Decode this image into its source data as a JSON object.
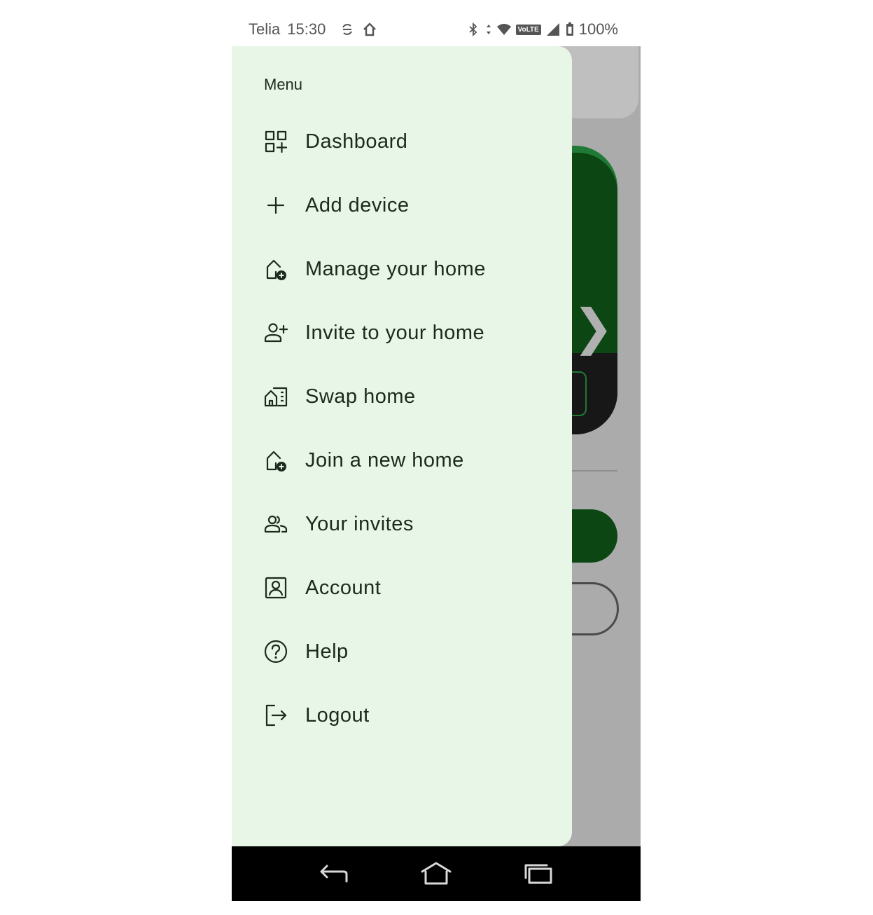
{
  "status_bar": {
    "carrier": "Telia",
    "time": "15:30",
    "network_badge": "VoLTE",
    "battery": "100%",
    "icons": [
      "sync-icon",
      "home-icon",
      "bluetooth-icon",
      "data-arrows-icon",
      "wifi-icon",
      "signal-icon",
      "battery-icon"
    ]
  },
  "drawer": {
    "title": "Menu",
    "items": [
      {
        "label": "Dashboard",
        "icon": "dashboard-icon"
      },
      {
        "label": "Add device",
        "icon": "plus-icon"
      },
      {
        "label": "Manage your home",
        "icon": "home-add-icon"
      },
      {
        "label": "Invite to your home",
        "icon": "person-add-icon"
      },
      {
        "label": "Swap home",
        "icon": "home-swap-icon"
      },
      {
        "label": "Join a new home",
        "icon": "home-add-icon"
      },
      {
        "label": "Your invites",
        "icon": "people-icon"
      },
      {
        "label": "Account",
        "icon": "account-box-icon"
      },
      {
        "label": "Help",
        "icon": "help-icon"
      },
      {
        "label": "Logout",
        "icon": "logout-icon"
      }
    ]
  },
  "nav_bar": {
    "buttons": [
      "back-icon",
      "home-icon",
      "recents-icon"
    ]
  },
  "colors": {
    "drawer_bg": "#e8f6e8",
    "scrim": "#ababab",
    "brand_green": "#0b4613",
    "text": "#1b2a1c"
  }
}
